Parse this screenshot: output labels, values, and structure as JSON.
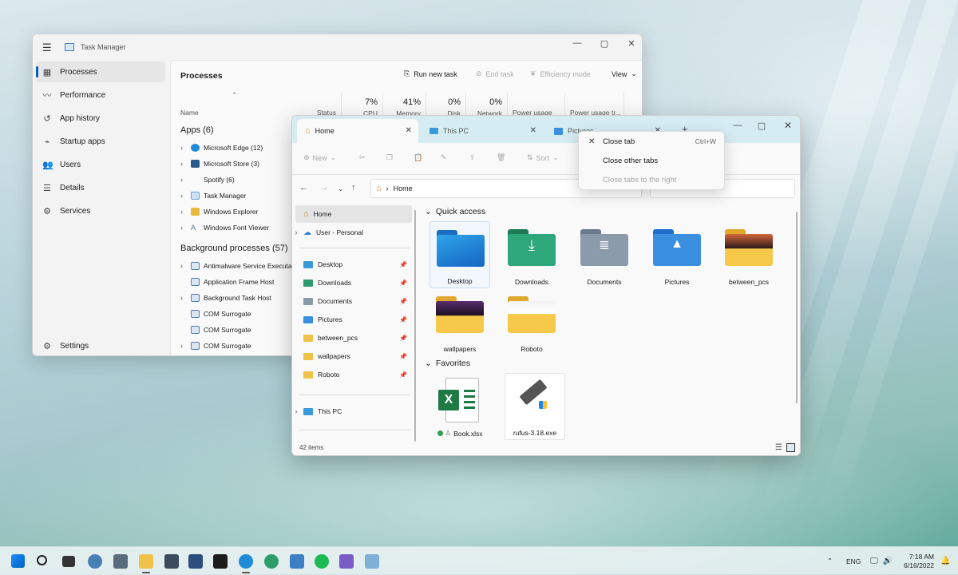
{
  "task_manager": {
    "title": "Task Manager",
    "nav": [
      {
        "label": "Processes",
        "icon": "processes-icon",
        "active": true
      },
      {
        "label": "Performance",
        "icon": "performance-icon"
      },
      {
        "label": "App history",
        "icon": "history-icon"
      },
      {
        "label": "Startup apps",
        "icon": "startup-icon"
      },
      {
        "label": "Users",
        "icon": "users-icon"
      },
      {
        "label": "Details",
        "icon": "details-icon"
      },
      {
        "label": "Services",
        "icon": "services-icon"
      }
    ],
    "settings_label": "Settings",
    "heading": "Processes",
    "toolbar": {
      "run_new_task": "Run new task",
      "end_task": "End task",
      "efficiency_mode": "Efficiency mode",
      "view": "View"
    },
    "columns": {
      "name": "Name",
      "status": "Status",
      "cpu_pct": "7%",
      "cpu": "CPU",
      "memory_pct": "41%",
      "memory": "Memory",
      "disk_pct": "0%",
      "disk": "Disk",
      "network_pct": "0%",
      "network": "Network",
      "power_usage": "Power usage",
      "power_trend": "Power usage tr..."
    },
    "apps_header": "Apps (6)",
    "apps": [
      {
        "name": "Microsoft Edge (12)",
        "expand": true,
        "color": "#1f8bd6"
      },
      {
        "name": "Microsoft Store (3)",
        "expand": true,
        "color": "#2a5a8c"
      },
      {
        "name": "Spotify (6)",
        "expand": true,
        "color": ""
      },
      {
        "name": "Task Manager",
        "expand": true,
        "color": "#6aa0d0"
      },
      {
        "name": "Windows Explorer",
        "expand": true,
        "color": "#e8b93a"
      },
      {
        "name": "Windows Font Viewer",
        "expand": true,
        "color": "#5a6ea8"
      }
    ],
    "bg_header": "Background processes (57)",
    "bg": [
      {
        "name": "Antimalware Service Executab",
        "expand": true
      },
      {
        "name": "Application Frame Host",
        "expand": false
      },
      {
        "name": "Background Task Host",
        "expand": true
      },
      {
        "name": "COM Surrogate",
        "expand": false
      },
      {
        "name": "COM Surrogate",
        "expand": false
      },
      {
        "name": "COM Surrogate",
        "expand": true
      }
    ]
  },
  "explorer": {
    "tabs": [
      {
        "label": "Home",
        "active": true
      },
      {
        "label": "This PC"
      },
      {
        "label": "Pictures"
      }
    ],
    "commands": {
      "new": "New",
      "sort": "Sort"
    },
    "address": "Home",
    "sidebar": {
      "home": "Home",
      "user": "User - Personal",
      "pinned": [
        "Desktop",
        "Downloads",
        "Documents",
        "Pictures",
        "between_pcs",
        "wallpapers",
        "Roboto"
      ],
      "this_pc": "This PC"
    },
    "quick_access_header": "Quick access",
    "quick_access": [
      "Desktop",
      "Downloads",
      "Documents",
      "Pictures",
      "between_pcs",
      "wallpapers",
      "Roboto"
    ],
    "favorites_header": "Favorites",
    "favorites": [
      "Book.xlsx",
      "rufus-3.18.exe"
    ],
    "status": "42 items"
  },
  "context_menu": {
    "close_tab": "Close tab",
    "close_tab_shortcut": "Ctrl+W",
    "close_other": "Close other tabs",
    "close_right": "Close tabs to the right"
  },
  "taskbar": {
    "lang": "ENG",
    "time": "7:18 AM",
    "date": "6/16/2022"
  }
}
